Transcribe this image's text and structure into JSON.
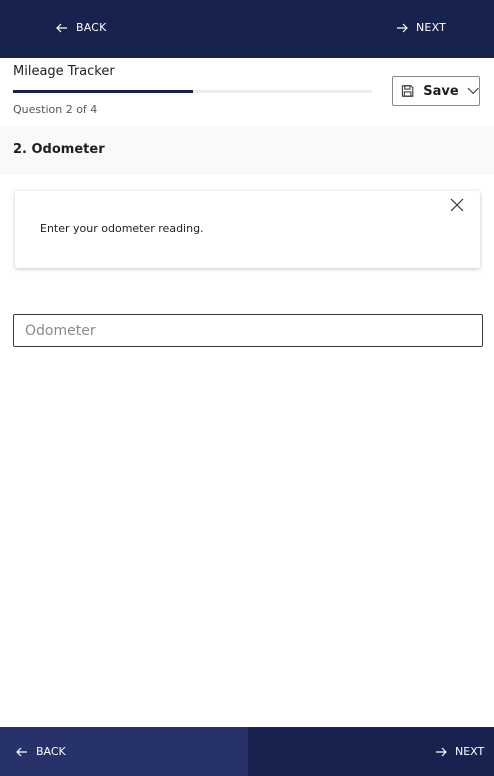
{
  "top_nav": {
    "back_label": "BACK",
    "next_label": "NEXT"
  },
  "form": {
    "title": "Mileage Tracker",
    "progress_fraction": 0.5,
    "question_count": "Question 2 of 4",
    "save_label": "Save"
  },
  "question": {
    "title": "2. Odometer",
    "info_text": "Enter your odometer reading.",
    "input_placeholder": "Odometer",
    "input_value": ""
  },
  "bottom_nav": {
    "back_label": "BACK",
    "next_label": "NEXT"
  },
  "icons": {
    "back": "arrow-left-icon",
    "next": "arrow-right-icon",
    "save": "floppy-disk-icon",
    "dropdown": "chevron-down-icon",
    "close": "close-icon"
  },
  "colors": {
    "nav_background": "#18224f",
    "nav_back_background": "#263269",
    "progress_fill": "#18224f",
    "question_band": "#faf9f8"
  }
}
